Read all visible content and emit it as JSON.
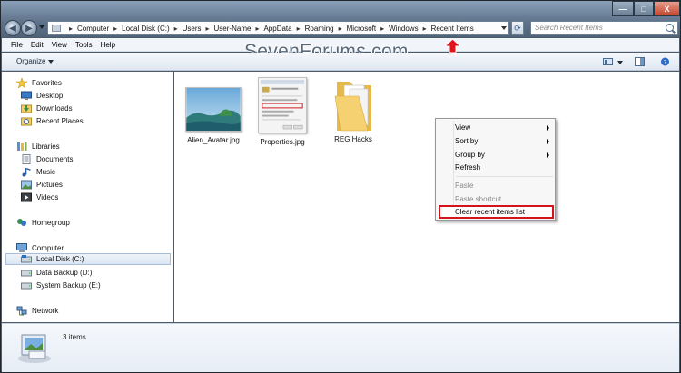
{
  "address": {
    "crumbs": [
      "Computer",
      "Local Disk (C:)",
      "Users",
      "User-Name",
      "AppData",
      "Roaming",
      "Microsoft",
      "Windows",
      "Recent Items"
    ]
  },
  "search": {
    "placeholder": "Search Recent Items"
  },
  "window_controls": {
    "minimize": "—",
    "maximize": "□",
    "close": "X"
  },
  "menu": {
    "file": "File",
    "edit": "Edit",
    "view": "View",
    "tools": "Tools",
    "help": "Help"
  },
  "watermark": "SevenForums.com",
  "toolbar": {
    "organize": "Organize"
  },
  "nav": {
    "favorites": "Favorites",
    "desktop": "Desktop",
    "downloads": "Downloads",
    "recent_places": "Recent Places",
    "libraries": "Libraries",
    "documents": "Documents",
    "music": "Music",
    "pictures": "Pictures",
    "videos": "Videos",
    "homegroup": "Homegroup",
    "computer": "Computer",
    "local_disk": "Local Disk (C:)",
    "data_backup": "Data Backup (D:)",
    "system_backup": "System Backup (E:)",
    "network": "Network"
  },
  "files": [
    {
      "name": "Alien_Avatar.jpg",
      "kind": "image"
    },
    {
      "name": "Properties.jpg",
      "kind": "image"
    },
    {
      "name": "REG Hacks",
      "kind": "folder"
    }
  ],
  "context_menu": {
    "view": "View",
    "sort_by": "Sort by",
    "group_by": "Group by",
    "refresh": "Refresh",
    "paste": "Paste",
    "paste_shortcut": "Paste shortcut",
    "clear_recent": "Clear recent items list"
  },
  "details": {
    "count": "3 items"
  },
  "colors": {
    "highlight_red": "#d4141a",
    "arrow_red": "#e0141a"
  }
}
